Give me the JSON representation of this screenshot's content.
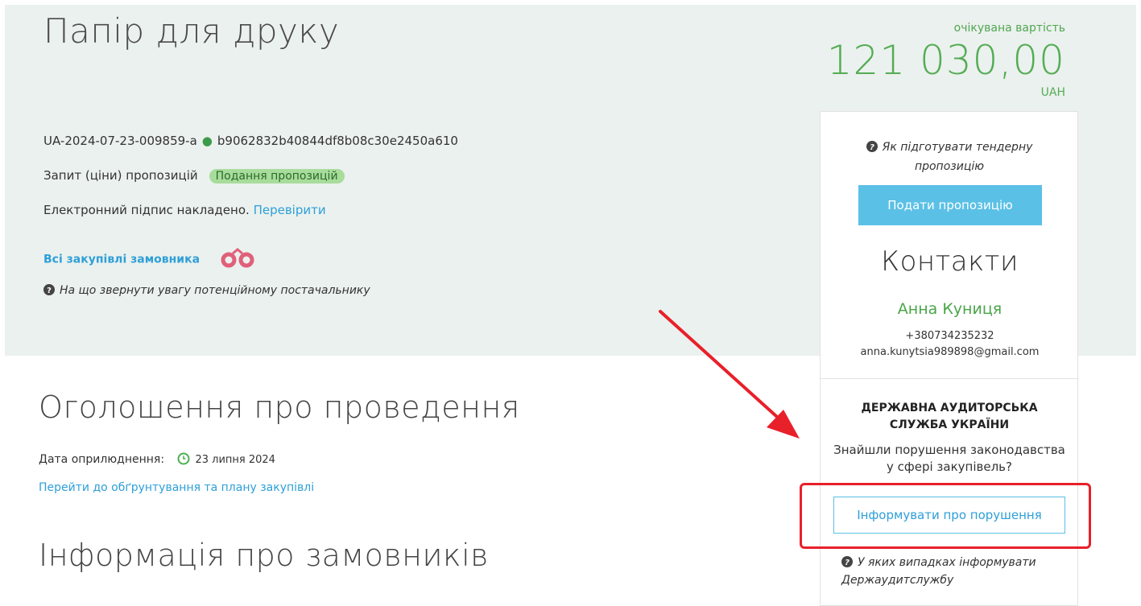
{
  "header": {
    "title": "Папір для друку",
    "tender_id": "UA-2024-07-23-009859-a",
    "hash": "b9062832b40844df8b08c30e2450a610",
    "procedure_type": "Запит (ціни) пропозицій",
    "status_badge": "Подання пропозицій",
    "signature_text": "Електронний підпис накладено.",
    "signature_link": "Перевірити",
    "all_purchases_link": "Всі закупівлі замовника",
    "supplier_hint": "На що звернути увагу потенційному постачальнику"
  },
  "price": {
    "label": "очікувана вартість",
    "value": "121 030,00",
    "currency": "UAH"
  },
  "panel": {
    "help_text": "Як підготувати тендерну пропозицію",
    "submit_button": "Подати пропозицію",
    "contacts_title": "Контакти",
    "contact_name": "Анна Куниця",
    "contact_phone": "+380734235232",
    "contact_email": "anna.kunytsia989898@gmail.com",
    "audit_title": "ДЕРЖАВНА АУДИТОРСЬКА СЛУЖБА УКРАЇНИ",
    "audit_question": "Знайшли порушення законодавства у сфері закупівель?",
    "report_button": "Інформувати про порушення",
    "audit_help": "У яких випадках інформувати Держаудитслужбу"
  },
  "announcement": {
    "title": "Оголошення про проведення",
    "date_label": "Дата оприлюднення:",
    "date_value": "23 липня 2024",
    "plan_link": "Перейти до обґрунтування та плану закупівлі"
  },
  "customers": {
    "title": "Інформація про замовників"
  },
  "colors": {
    "hero_bg": "#ebf1ee",
    "accent_green": "#54ac54",
    "link_blue": "#2e9fd8",
    "button_blue": "#5bc0e6",
    "annotation_red": "#e8202a"
  }
}
